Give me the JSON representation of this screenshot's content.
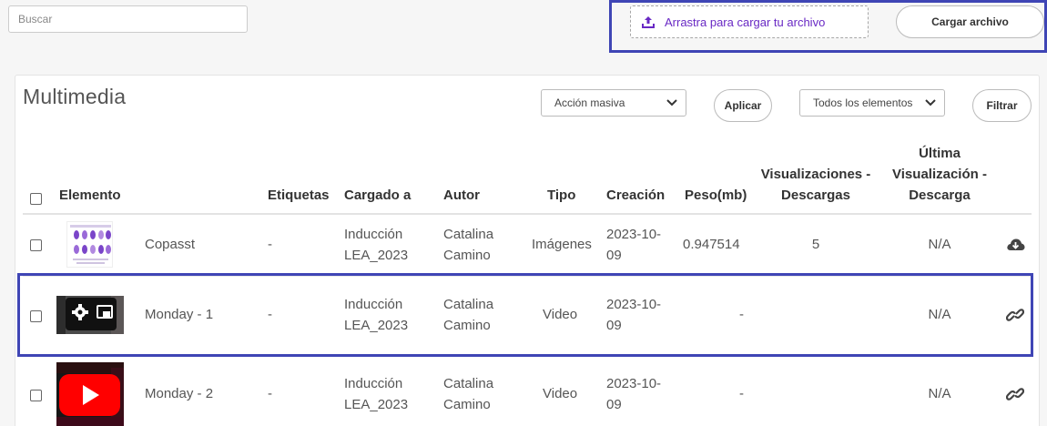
{
  "search": {
    "placeholder": "Buscar",
    "value": ""
  },
  "upload": {
    "dropzone_label": "Arrastra para cargar tu archivo",
    "button_label": "Cargar archivo"
  },
  "panel": {
    "title": "Multimedia",
    "bulk_action": "Acción masiva",
    "apply_label": "Aplicar",
    "filter_select": "Todos los elementos",
    "filter_label": "Filtrar"
  },
  "columns": {
    "element": "Elemento",
    "tags": "Etiquetas",
    "uploaded_to": "Cargado a",
    "author": "Autor",
    "type": "Tipo",
    "created": "Creación",
    "weight": "Peso(mb)",
    "views_1": "Visualizaciones -",
    "views_2": "Descargas",
    "last_1": "Última",
    "last_2": "Visualización -",
    "last_3": "Descarga"
  },
  "rows": [
    {
      "name": "Copasst",
      "tags": "-",
      "uploaded_1": "Inducción",
      "uploaded_2": "LEA_2023",
      "author_1": "Catalina",
      "author_2": "Camino",
      "type": "Imágenes",
      "created_1": "2023-10-",
      "created_2": "09",
      "weight": "0.947514",
      "views": "5",
      "last": "N/A",
      "action_icon": "cloud-download-icon"
    },
    {
      "name": "Monday - 1",
      "tags": "-",
      "uploaded_1": "Inducción",
      "uploaded_2": "LEA_2023",
      "author_1": "Catalina",
      "author_2": "Camino",
      "type": "Video",
      "created_1": "2023-10-",
      "created_2": "09",
      "weight": "-",
      "views": "",
      "last": "N/A",
      "action_icon": "link-icon"
    },
    {
      "name": "Monday - 2",
      "tags": "-",
      "uploaded_1": "Inducción",
      "uploaded_2": "LEA_2023",
      "author_1": "Catalina",
      "author_2": "Camino",
      "type": "Video",
      "created_1": "2023-10-",
      "created_2": "09",
      "weight": "-",
      "views": "",
      "last": "N/A",
      "action_icon": "link-icon"
    }
  ],
  "colors": {
    "accent": "#6929c4",
    "highlight": "#3f45b5",
    "youtube_red": "#ff0000"
  }
}
